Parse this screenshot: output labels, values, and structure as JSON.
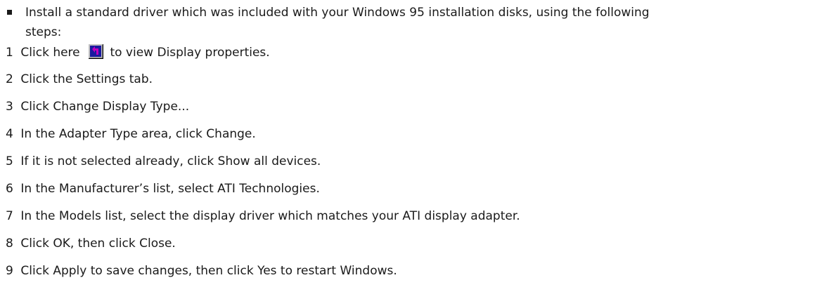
{
  "intro": {
    "text": "Install a standard driver which was included with your Windows 95 installation disks, using the following",
    "continuation": "steps:"
  },
  "steps": [
    {
      "num": "1",
      "before": "Click here",
      "after": "to view Display properties."
    },
    {
      "num": "2",
      "text": "Click the Settings tab."
    },
    {
      "num": "3",
      "text": "Click Change Display Type..."
    },
    {
      "num": "4",
      "text": "In the Adapter Type area, click Change."
    },
    {
      "num": "5",
      "text": "If it is not selected already, click Show all devices."
    },
    {
      "num": "6",
      "text": "In the Manufacturer’s list, select ATI Technologies."
    },
    {
      "num": "7",
      "text": "In the Models list, select the display driver which matches your ATI display adapter."
    },
    {
      "num": "8",
      "text": "Click OK, then click Close."
    },
    {
      "num": "9",
      "text": "Click Apply to save changes, then click Yes to restart Windows."
    }
  ],
  "icons": {
    "shortcut": "shortcut-arrow-icon"
  }
}
